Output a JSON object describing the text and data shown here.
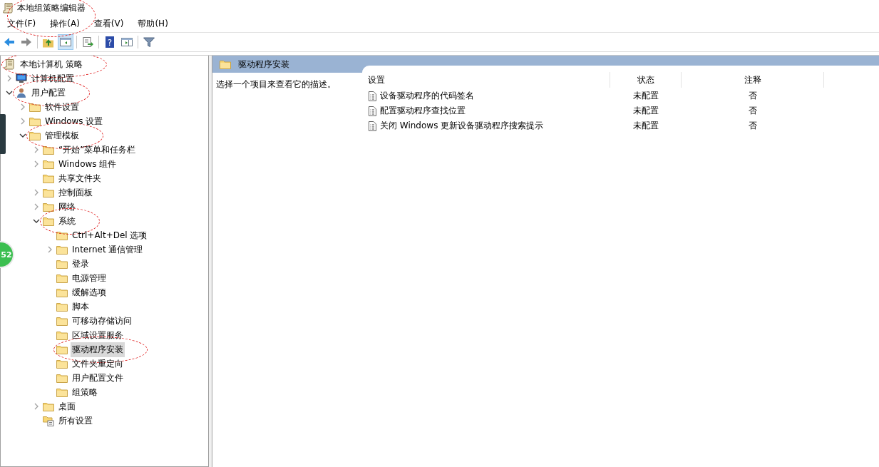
{
  "window": {
    "title": "本地组策略编辑器",
    "circled": true
  },
  "menu": [
    {
      "label": "文件(F)"
    },
    {
      "label": "操作(A)"
    },
    {
      "label": "查看(V)"
    },
    {
      "label": "帮助(H)"
    }
  ],
  "toolbar": [
    {
      "kind": "back",
      "selected": false
    },
    {
      "kind": "forward",
      "selected": false
    },
    {
      "kind": "separator"
    },
    {
      "kind": "up",
      "selected": false
    },
    {
      "kind": "tree",
      "selected": true
    },
    {
      "kind": "separator"
    },
    {
      "kind": "export",
      "selected": false
    },
    {
      "kind": "separator"
    },
    {
      "kind": "help",
      "selected": false,
      "glyph": "?"
    },
    {
      "kind": "pane",
      "selected": false
    },
    {
      "kind": "separator"
    },
    {
      "kind": "filter",
      "selected": false
    }
  ],
  "tree": {
    "label": "本地计算机 策略",
    "kind": "policy",
    "selected": false,
    "circled": true,
    "children": [
      {
        "label": "计算机配置",
        "kind": "computer",
        "expanded": false,
        "selected": false
      },
      {
        "label": "用户配置",
        "kind": "user",
        "expanded": true,
        "selected": false,
        "circled": true,
        "children": [
          {
            "label": "软件设置",
            "kind": "folder",
            "expanded": false,
            "selected": false
          },
          {
            "label": "Windows 设置",
            "kind": "folder",
            "expanded": false,
            "selected": false
          },
          {
            "label": "管理模板",
            "kind": "folder",
            "expanded": true,
            "selected": false,
            "circled": true,
            "children": [
              {
                "label": "“开始”菜单和任务栏",
                "kind": "folder",
                "expanded": false,
                "selected": false
              },
              {
                "label": "Windows 组件",
                "kind": "folder",
                "expanded": false,
                "selected": false
              },
              {
                "label": "共享文件夹",
                "kind": "folder",
                "selected": false
              },
              {
                "label": "控制面板",
                "kind": "folder",
                "expanded": false,
                "selected": false
              },
              {
                "label": "网络",
                "kind": "folder",
                "expanded": false,
                "selected": false
              },
              {
                "label": "系统",
                "kind": "folder",
                "expanded": true,
                "selected": false,
                "circled": true,
                "children": [
                  {
                    "label": "Ctrl+Alt+Del 选项",
                    "kind": "folder",
                    "selected": false
                  },
                  {
                    "label": "Internet 通信管理",
                    "kind": "folder",
                    "expanded": false,
                    "selected": false
                  },
                  {
                    "label": "登录",
                    "kind": "folder",
                    "selected": false
                  },
                  {
                    "label": "电源管理",
                    "kind": "folder",
                    "selected": false
                  },
                  {
                    "label": "缓解选项",
                    "kind": "folder",
                    "selected": false
                  },
                  {
                    "label": "脚本",
                    "kind": "folder",
                    "selected": false
                  },
                  {
                    "label": "可移动存储访问",
                    "kind": "folder",
                    "selected": false
                  },
                  {
                    "label": "区域设置服务",
                    "kind": "folder",
                    "selected": false
                  },
                  {
                    "label": "驱动程序安装",
                    "kind": "folder",
                    "selected": true,
                    "circled": true
                  },
                  {
                    "label": "文件夹重定向",
                    "kind": "folder",
                    "selected": false
                  },
                  {
                    "label": "用户配置文件",
                    "kind": "folder",
                    "selected": false
                  },
                  {
                    "label": "组策略",
                    "kind": "folder",
                    "selected": false
                  }
                ]
              },
              {
                "label": "桌面",
                "kind": "folder",
                "expanded": false,
                "selected": false
              },
              {
                "label": "所有设置",
                "kind": "all-settings",
                "selected": false
              }
            ]
          }
        ]
      }
    ]
  },
  "detail": {
    "title": "驱动程序安装",
    "description": "选择一个项目来查看它的描述。",
    "columns": [
      "设置",
      "状态",
      "注释"
    ],
    "rows": [
      {
        "setting": "设备驱动程序的代码签名",
        "state": "未配置",
        "comment": "否"
      },
      {
        "setting": "配置驱动程序查找位置",
        "state": "未配置",
        "comment": "否"
      },
      {
        "setting": "关闭 Windows 更新设备驱动程序搜索提示",
        "state": "未配置",
        "comment": "否"
      }
    ]
  },
  "floating_badge": {
    "text": "52"
  }
}
